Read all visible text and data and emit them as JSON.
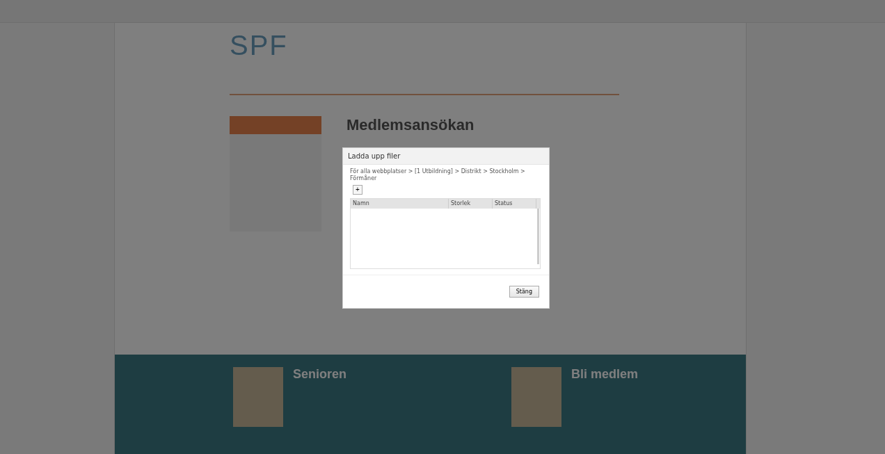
{
  "page": {
    "logo": "SPF",
    "heading": "Medlemsansökan",
    "footer_columns": [
      {
        "heading": "Senioren"
      },
      {
        "heading": "Bli medlem"
      }
    ]
  },
  "dialog": {
    "title": "Ladda upp filer",
    "breadcrumb": "För alla webbplatser > [1 Utbildning] > Distrikt > Stockholm > Förmåner",
    "add_button": "+",
    "columns": [
      "Namn",
      "Storlek",
      "Status"
    ],
    "close_button": "Stäng"
  }
}
